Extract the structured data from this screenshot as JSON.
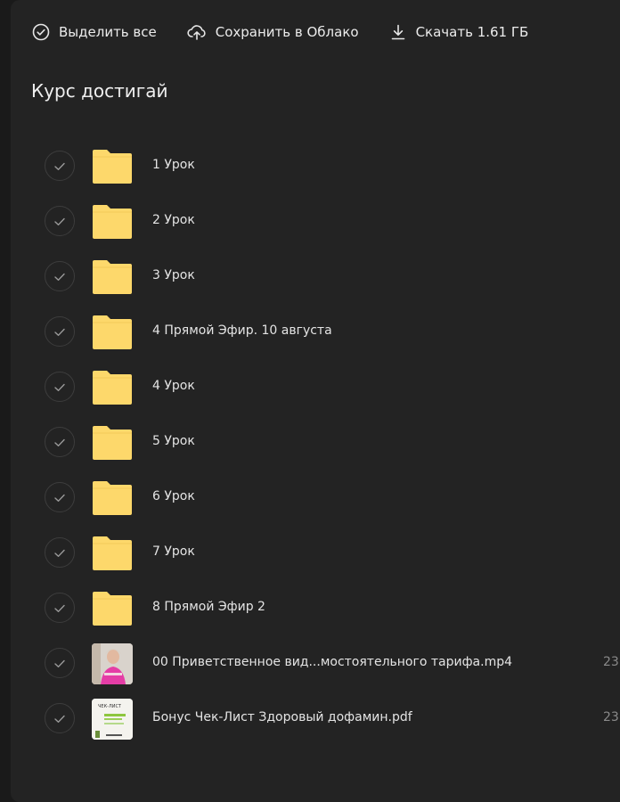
{
  "toolbar": {
    "select_all": "Выделить все",
    "save_to_cloud": "Сохранить в Облако",
    "download": "Скачать 1.61 ГБ"
  },
  "folder_title": "Курс достигай",
  "items": [
    {
      "name": "1 Урок",
      "type": "folder"
    },
    {
      "name": "2 Урок",
      "type": "folder"
    },
    {
      "name": "3 Урок",
      "type": "folder"
    },
    {
      "name": "4 Прямой Эфир. 10 августа",
      "type": "folder"
    },
    {
      "name": "4 Урок",
      "type": "folder"
    },
    {
      "name": "5 Урок",
      "type": "folder"
    },
    {
      "name": "6 Урок",
      "type": "folder"
    },
    {
      "name": "7 Урок",
      "type": "folder"
    },
    {
      "name": "8 Прямой Эфир 2",
      "type": "folder"
    },
    {
      "name": "00 Приветственное вид...мостоятельного тарифа.mp4",
      "type": "video",
      "date": "23"
    },
    {
      "name": "Бонус Чек-Лист Здоровый дофамин.pdf",
      "type": "pdf",
      "date": "23",
      "thumb_text": "ЧЕК-ЛИСТ"
    }
  ],
  "colors": {
    "background": "#1a1a1a",
    "panel": "#232323",
    "folder": "#fdd86b",
    "text": "#e4e4e4"
  }
}
